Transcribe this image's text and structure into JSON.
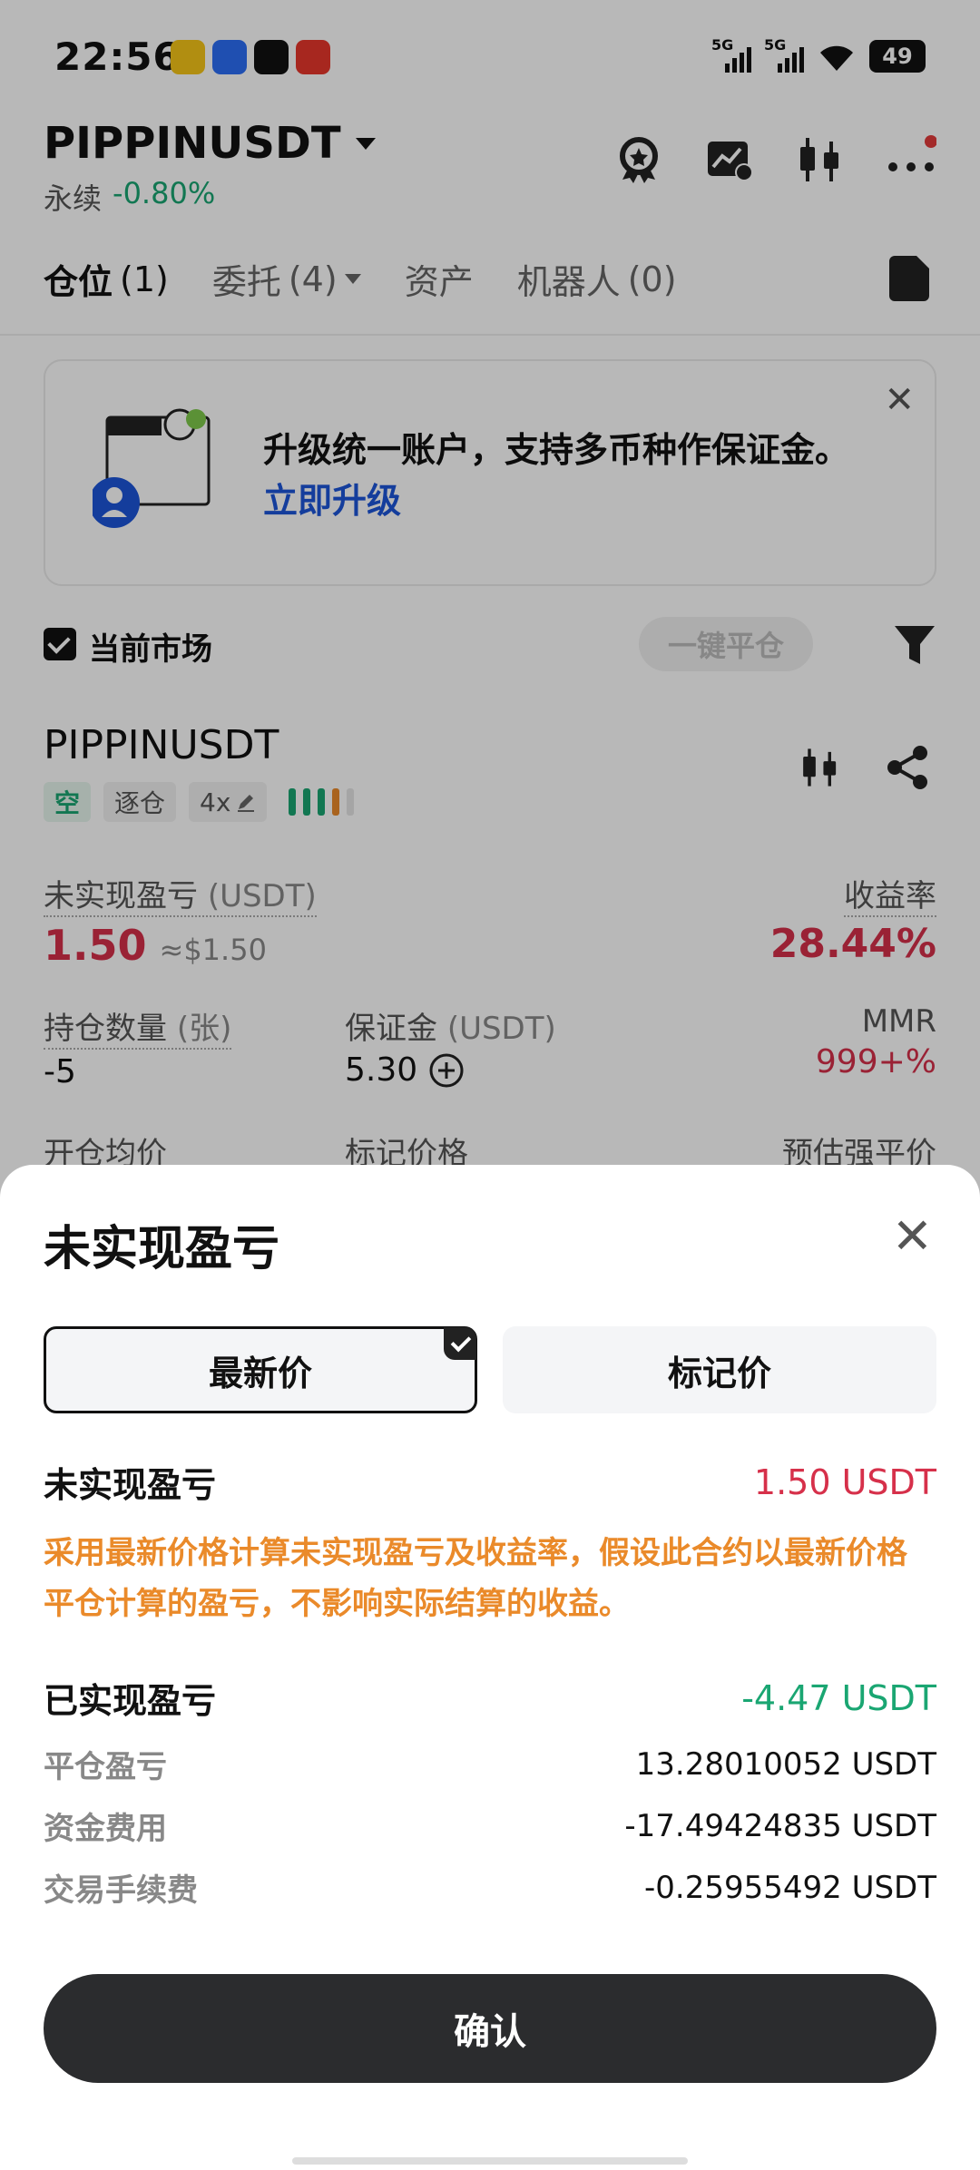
{
  "status_bar": {
    "time": "22:56",
    "signal1": "5G",
    "signal2": "5G",
    "battery": "49",
    "app_icons": [
      "app-icon-1",
      "app-icon-2",
      "tiktok-icon",
      "app-icon-4"
    ]
  },
  "header": {
    "pair": "PIPPINUSDT",
    "contract_type": "永续",
    "change": "-0.80%"
  },
  "tabs": [
    {
      "label": "仓位",
      "count": "(1)"
    },
    {
      "label": "委托",
      "count": "(4)"
    },
    {
      "label": "资产",
      "count": ""
    },
    {
      "label": "机器人",
      "count": "(0)"
    }
  ],
  "banner": {
    "text": "升级统一账户，支持多币种作保证金。",
    "link": "立即升级"
  },
  "filter": {
    "current_market": "当前市场",
    "close_all": "一键平仓"
  },
  "position": {
    "symbol": "PIPPINUSDT",
    "side": "空",
    "margin_mode": "逐仓",
    "leverage": "4x",
    "unrealized_label": "未实现盈亏",
    "unrealized_unit": "(USDT)",
    "unrealized_value": "1.50",
    "unrealized_approx": "≈$1.50",
    "roe_label": "收益率",
    "roe_value": "28.44%",
    "qty_label": "持仓数量",
    "qty_unit": "(张)",
    "qty_value": "-5",
    "margin_label": "保证金",
    "margin_unit": "(USDT)",
    "margin_value": "5.30",
    "mmr_label": "MMR",
    "mmr_value": "999+%",
    "entry_label": "开仓均价",
    "mark_label": "标记价格",
    "liq_label": "预估强平价"
  },
  "sheet": {
    "title": "未实现盈亏",
    "seg_latest": "最新价",
    "seg_mark": "标记价",
    "unrealized_label": "未实现盈亏",
    "unrealized_value": "1.50 USDT",
    "note": "采用最新价格计算未实现盈亏及收益率，假设此合约以最新价格平仓计算的盈亏，不影响实际结算的收益。",
    "realized_label": "已实现盈亏",
    "realized_value": "-4.47 USDT",
    "close_pnl_label": "平仓盈亏",
    "close_pnl_value": "13.28010052 USDT",
    "funding_label": "资金费用",
    "funding_value": "-17.49424835 USDT",
    "fee_label": "交易手续费",
    "fee_value": "-0.25955492 USDT",
    "confirm": "确认"
  },
  "colors": {
    "red": "#d6304a",
    "green": "#1aa672",
    "orange": "#ea8a2a",
    "link_blue": "#1c55d8",
    "button_dark": "#2b2c2e"
  }
}
